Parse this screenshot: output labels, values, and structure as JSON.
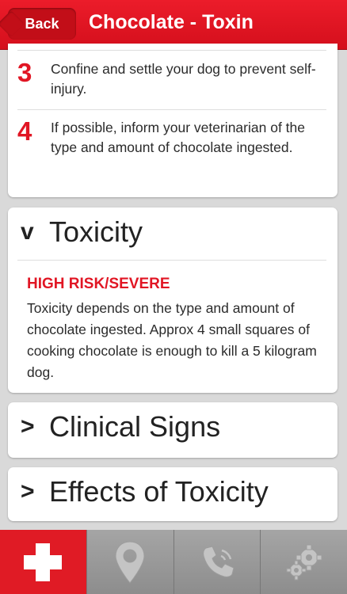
{
  "header": {
    "back_label": "Back",
    "title": "Chocolate - Toxin"
  },
  "steps": [
    {
      "num": "3",
      "text": "Confine and settle your dog to prevent self-injury."
    },
    {
      "num": "4",
      "text": "If possible, inform your veterinarian of the type and amount of chocolate ingested."
    }
  ],
  "sections": {
    "toxicity": {
      "chevron": "v",
      "label": "Toxicity",
      "risk": "HIGH RISK/SEVERE",
      "text": "Toxicity depends on the type and amount of chocolate ingested. Approx 4 small squares of cooking chocolate is enough to kill a 5 kilogram dog."
    },
    "clinical": {
      "chevron": ">",
      "label": "Clinical Signs"
    },
    "effects": {
      "chevron": ">",
      "label": "Effects of Toxicity"
    }
  },
  "tabbar": {
    "tabs": [
      {
        "icon": "first-aid-cross-icon",
        "active": true
      },
      {
        "icon": "map-pin-icon",
        "active": false
      },
      {
        "icon": "phone-icon",
        "active": false
      },
      {
        "icon": "gears-icon",
        "active": false
      }
    ]
  },
  "colors": {
    "accent": "#e11624",
    "tab_inactive": "#9a9a9a",
    "background": "#d9d9d9"
  }
}
